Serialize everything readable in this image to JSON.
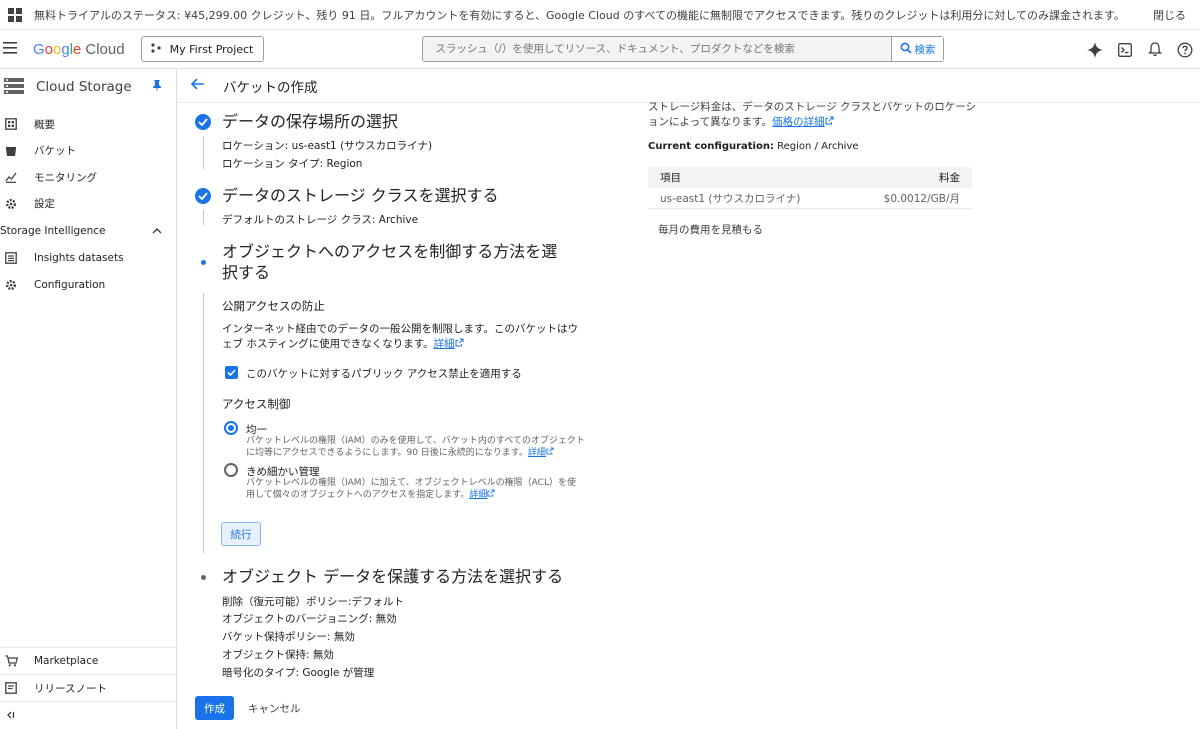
{
  "banner": {
    "text": "無料トライアルのステータス: ¥45,299.00 クレジット、残り 91 日。フルアカウントを有効にすると、Google Cloud のすべての機能に無制限でアクセスできます。残りのクレジットは利用分に対してのみ課金されます。",
    "close": "閉じる"
  },
  "topbar": {
    "logo_letters": [
      "G",
      "o",
      "o",
      "g",
      "l",
      "e"
    ],
    "logo_cloud": "Cloud",
    "project": "My First Project",
    "search_placeholder": "スラッシュ（/）を使用してリソース、ドキュメント、プロダクトなどを検索",
    "search_button": "検索"
  },
  "sidebar": {
    "title": "Cloud Storage",
    "items": [
      {
        "label": "概要",
        "icon": "overview-icon"
      },
      {
        "label": "バケット",
        "icon": "bucket-icon"
      },
      {
        "label": "モニタリング",
        "icon": "monitoring-icon"
      },
      {
        "label": "設定",
        "icon": "settings-icon"
      }
    ],
    "section": "Storage Intelligence",
    "section_items": [
      {
        "label": "Insights datasets",
        "icon": "datasets-icon"
      },
      {
        "label": "Configuration",
        "icon": "configuration-icon"
      }
    ],
    "bottom": [
      {
        "label": "Marketplace",
        "icon": "marketplace-icon"
      },
      {
        "label": "リリースノート",
        "icon": "release-notes-icon"
      }
    ]
  },
  "page": {
    "title": "バケットの作成"
  },
  "steps": {
    "location": {
      "title": "データの保存場所の選択",
      "line1": "ロケーション: us-east1 (サウスカロライナ)",
      "line2": "ロケーション タイプ: Region"
    },
    "storage_class": {
      "title": "データのストレージ クラスを選択する",
      "line1": "デフォルトのストレージ クラス: Archive"
    },
    "access": {
      "title_line1": "オブジェクトへのアクセスを制御する方法を選",
      "title_line2": "択する",
      "public_heading": "公開アクセスの防止",
      "public_desc1": "インターネット経由でのデータの一般公開を制限します。このバケットはウ",
      "public_desc2": "ェブ ホスティングに使用できなくなります。",
      "detail_link": "詳細",
      "checkbox_label": "このバケットに対するパブリック アクセス禁止を適用する",
      "checkbox_checked": true,
      "access_heading": "アクセス制御",
      "uniform_label": "均一",
      "uniform_desc1": "バケットレベルの権限（IAM）のみを使用して、バケット内のすべてのオブジェクト",
      "uniform_desc2": "に均等にアクセスできるようにします。90 日後に永続的になります。",
      "fine_label": "きめ細かい管理",
      "fine_desc1": "バケットレベルの権限（IAM）に加えて、オブジェクトレベルの権限（ACL）を使",
      "fine_desc2": "用して個々のオブジェクトへのアクセスを指定します。",
      "continue": "続行",
      "selected": "uniform"
    },
    "protect": {
      "title": "オブジェクト データを保護する方法を選択する",
      "lines": [
        "削除（復元可能）ポリシー:デフォルト",
        "オブジェクトのバージョニング: 無効",
        "バケット保持ポリシー: 無効",
        "オブジェクト保持: 無効",
        "暗号化のタイプ: Google が管理"
      ]
    }
  },
  "actions": {
    "create": "作成",
    "cancel": "キャンセル"
  },
  "pricing": {
    "desc_top": "ストレージ料金は、データのストレージ クラスとバケットのロケーシ",
    "desc_line2": "ョンによって異なります。",
    "price_link": "価格の詳細",
    "config_label": "Current configuration:",
    "config_value": "Region / Archive",
    "table_headers": [
      "項目",
      "料金"
    ],
    "rows": [
      {
        "item": "us-east1 (サウスカロライナ)",
        "price": "$0.0012/GB/月"
      }
    ],
    "estimate": "毎月の費用を見積もる"
  },
  "colors": {
    "accent": "#1a73e8"
  }
}
